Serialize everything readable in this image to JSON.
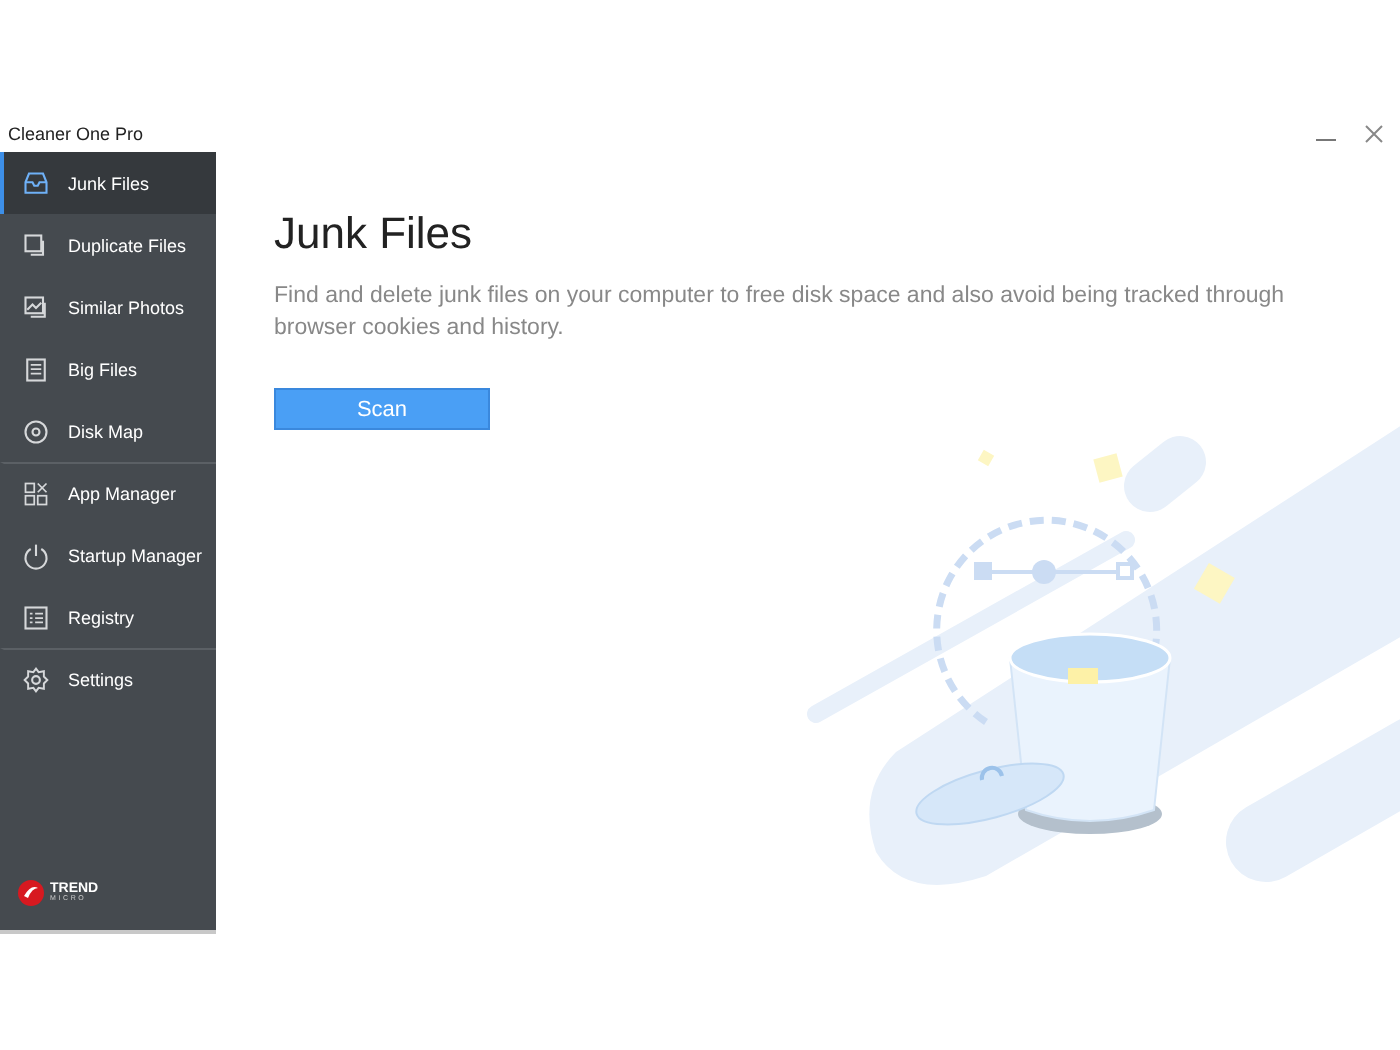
{
  "window": {
    "title": "Cleaner One Pro"
  },
  "sidebar": {
    "items": [
      {
        "label": "Junk Files",
        "selected": true,
        "divider_before": false
      },
      {
        "label": "Duplicate Files",
        "selected": false,
        "divider_before": false
      },
      {
        "label": "Similar Photos",
        "selected": false,
        "divider_before": false
      },
      {
        "label": "Big Files",
        "selected": false,
        "divider_before": false
      },
      {
        "label": "Disk Map",
        "selected": false,
        "divider_before": false
      },
      {
        "label": "App Manager",
        "selected": false,
        "divider_before": true
      },
      {
        "label": "Startup Manager",
        "selected": false,
        "divider_before": false
      },
      {
        "label": "Registry",
        "selected": false,
        "divider_before": false
      },
      {
        "label": "Settings",
        "selected": false,
        "divider_before": true
      }
    ],
    "logo": {
      "name": "TREND",
      "subtitle": "MICRO"
    }
  },
  "main": {
    "title": "Junk Files",
    "description": "Find and delete junk files on your computer to free disk space and also avoid being tracked through browser cookies and history.",
    "button": "Scan"
  }
}
